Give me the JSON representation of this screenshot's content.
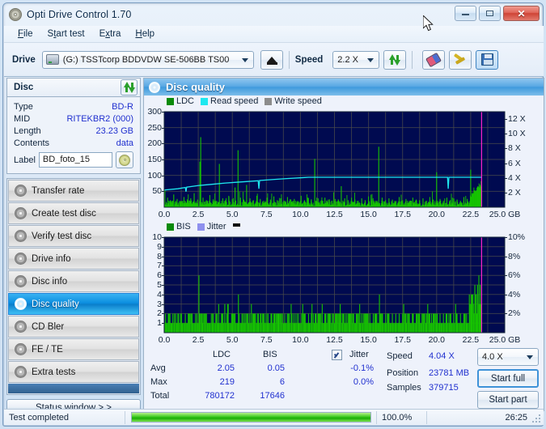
{
  "window": {
    "title": "Opti Drive Control 1.70",
    "icon": "disc-icon",
    "buttons": {
      "minimize": "_",
      "maximize": "□",
      "close": "✕"
    }
  },
  "menu": {
    "items": [
      "File",
      "Start test",
      "Extra",
      "Help"
    ]
  },
  "toolbar": {
    "drive_label": "Drive",
    "drive_value": "(G:)  TSSTcorp BDDVDW SE-506BB TS00",
    "eject_icon": "eject-icon",
    "speed_label": "Speed",
    "speed_value": "2.2 X",
    "refresh_icon": "refresh-icon",
    "erase_icon": "erase-icon",
    "tools_icon": "tools-icon",
    "save_icon": "save-icon"
  },
  "disc": {
    "header": "Disc",
    "refresh_icon": "refresh-icon",
    "fields": [
      {
        "key": "Type",
        "value": "BD-R"
      },
      {
        "key": "MID",
        "value": "RITEKBR2 (000)"
      },
      {
        "key": "Length",
        "value": "23.23 GB"
      },
      {
        "key": "Contents",
        "value": "data"
      }
    ],
    "label_key": "Label",
    "label_value": "BD_foto_15",
    "disc_icon": "cd-icon"
  },
  "nav": {
    "items": [
      {
        "label": "Transfer rate",
        "active": false
      },
      {
        "label": "Create test disc",
        "active": false
      },
      {
        "label": "Verify test disc",
        "active": false
      },
      {
        "label": "Drive info",
        "active": false
      },
      {
        "label": "Disc info",
        "active": false
      },
      {
        "label": "Disc quality",
        "active": true
      },
      {
        "label": "CD Bler",
        "active": false
      },
      {
        "label": "FE / TE",
        "active": false
      },
      {
        "label": "Extra tests",
        "active": false
      }
    ],
    "status_button": "Status window > >"
  },
  "panel": {
    "title": "Disc quality",
    "icon": "disc-quality-icon"
  },
  "stats": {
    "col_ldc": "LDC",
    "col_bis": "BIS",
    "jitter_label": "Jitter",
    "jitter_checked": true,
    "rows": [
      {
        "label": "Avg",
        "ldc": "2.05",
        "bis": "0.05",
        "jitter": "-0.1%"
      },
      {
        "label": "Max",
        "ldc": "219",
        "bis": "6",
        "jitter": "0.0%"
      },
      {
        "label": "Total",
        "ldc": "780172",
        "bis": "17646",
        "jitter": ""
      }
    ],
    "speed_label": "Speed",
    "speed_value": "4.04 X",
    "position_label": "Position",
    "position_value": "23781 MB",
    "samples_label": "Samples",
    "samples_value": "379715",
    "speed_select": "4.0 X",
    "start_full": "Start full",
    "start_part": "Start part"
  },
  "statusbar": {
    "message": "Test completed",
    "percent": "100.0%",
    "percent_value": 100,
    "elapsed": "26:25"
  },
  "colors": {
    "ldc": "#16c400",
    "bis": "#16c400",
    "read_speed": "#1ee8f0",
    "write_speed": "#8c8c8c",
    "jitter": "#8e90ee",
    "plot_bg": "#000a50",
    "marker": "#ff22cc",
    "accent": "#2030cf"
  },
  "chart_data": [
    {
      "type": "line",
      "name": "disc-quality-ldc",
      "title": "Disc quality",
      "xlabel": "GB",
      "ylabel": "LDC",
      "xlim": [
        0,
        25
      ],
      "ylim": [
        0,
        300
      ],
      "y2lim": [
        0,
        12.5
      ],
      "y2label": "X",
      "xticks": [
        "0.0",
        "2.5",
        "5.0",
        "7.5",
        "10.0",
        "12.5",
        "15.0",
        "17.5",
        "20.0",
        "22.5",
        "25.0 GB"
      ],
      "yticks": [
        50,
        100,
        150,
        200,
        250,
        300
      ],
      "y2ticks": [
        "2 X",
        "4 X",
        "6 X",
        "8 X",
        "10 X",
        "12 X"
      ],
      "grid": true,
      "legend": [
        "LDC",
        "Read speed",
        "Write speed"
      ],
      "legend_position": "top-left",
      "marker_x": 23.3,
      "series": [
        {
          "name": "LDC",
          "color": "#16c400",
          "kind": "spikes",
          "baseline": 12,
          "spikes": [
            [
              0.05,
              55
            ],
            [
              0.25,
              30
            ],
            [
              0.45,
              22
            ],
            [
              0.7,
              40
            ],
            [
              0.95,
              26
            ],
            [
              1.2,
              18
            ],
            [
              1.45,
              32
            ],
            [
              1.7,
              20
            ],
            [
              1.95,
              28
            ],
            [
              2.2,
              44
            ],
            [
              2.45,
              24
            ],
            [
              2.62,
              143
            ],
            [
              2.68,
              220
            ],
            [
              2.85,
              30
            ],
            [
              3.1,
              22
            ],
            [
              3.35,
              38
            ],
            [
              3.6,
              25
            ],
            [
              3.85,
              20
            ],
            [
              4.05,
              136
            ],
            [
              4.3,
              28
            ],
            [
              4.5,
              22
            ],
            [
              4.75,
              34
            ],
            [
              5.0,
              26
            ],
            [
              5.2,
              62
            ],
            [
              5.42,
              179
            ],
            [
              5.6,
              30
            ],
            [
              5.85,
              24
            ],
            [
              6.05,
              70
            ],
            [
              6.3,
              28
            ],
            [
              6.55,
              22
            ],
            [
              6.8,
              36
            ],
            [
              7.05,
              26
            ],
            [
              7.3,
              20
            ],
            [
              7.55,
              30
            ],
            [
              7.8,
              24
            ],
            [
              8.05,
              34
            ],
            [
              8.3,
              22
            ],
            [
              8.55,
              28
            ],
            [
              8.8,
              20
            ],
            [
              9.05,
              32
            ],
            [
              9.3,
              24
            ],
            [
              9.55,
              26
            ],
            [
              9.8,
              20
            ],
            [
              10.05,
              36
            ],
            [
              10.3,
              22
            ],
            [
              10.55,
              30
            ],
            [
              10.8,
              25
            ],
            [
              11.05,
              152
            ],
            [
              11.3,
              28
            ],
            [
              11.55,
              22
            ],
            [
              11.8,
              30
            ],
            [
              12.05,
              24
            ],
            [
              12.3,
              20
            ],
            [
              12.55,
              26
            ],
            [
              12.8,
              22
            ],
            [
              13.0,
              66
            ],
            [
              13.25,
              28
            ],
            [
              13.5,
              22
            ],
            [
              13.75,
              30
            ],
            [
              14.0,
              24
            ],
            [
              14.25,
              20
            ],
            [
              14.5,
              28
            ],
            [
              14.75,
              22
            ],
            [
              15.0,
              34
            ],
            [
              15.25,
              26
            ],
            [
              15.5,
              20
            ],
            [
              15.75,
              190
            ],
            [
              16.0,
              30
            ],
            [
              16.25,
              22
            ],
            [
              16.5,
              28
            ],
            [
              16.75,
              24
            ],
            [
              17.0,
              20
            ],
            [
              17.25,
              32
            ],
            [
              17.5,
              22
            ],
            [
              17.75,
              26
            ],
            [
              18.0,
              20
            ],
            [
              18.25,
              30
            ],
            [
              18.5,
              24
            ],
            [
              18.75,
              22
            ],
            [
              19.0,
              28
            ],
            [
              19.25,
              20
            ],
            [
              19.5,
              32
            ],
            [
              19.75,
              24
            ],
            [
              20.0,
              110
            ],
            [
              20.25,
              26
            ],
            [
              20.5,
              20
            ],
            [
              20.75,
              30
            ],
            [
              21.0,
              22
            ],
            [
              21.25,
              28
            ],
            [
              21.5,
              24
            ],
            [
              21.75,
              20
            ],
            [
              22.0,
              32
            ],
            [
              22.25,
              26
            ],
            [
              22.5,
              118
            ],
            [
              22.7,
              40
            ],
            [
              22.85,
              52
            ],
            [
              23.0,
              46
            ],
            [
              23.1,
              58
            ],
            [
              23.2,
              62
            ],
            [
              23.3,
              55
            ]
          ]
        },
        {
          "name": "Read speed",
          "color": "#1ee8f0",
          "kind": "line",
          "points": [
            [
              0.0,
              54
            ],
            [
              1.0,
              58
            ],
            [
              1.55,
              62
            ],
            [
              1.6,
              49
            ],
            [
              1.65,
              63
            ],
            [
              2.5,
              68
            ],
            [
              3.5,
              72
            ],
            [
              4.5,
              76
            ],
            [
              5.5,
              79
            ],
            [
              6.9,
              83
            ],
            [
              6.95,
              58
            ],
            [
              7.0,
              84
            ],
            [
              8.0,
              87
            ],
            [
              9.0,
              90
            ],
            [
              10.2,
              93
            ],
            [
              10.6,
              94
            ],
            [
              13.0,
              94
            ],
            [
              17.0,
              94
            ],
            [
              20.8,
              94
            ],
            [
              20.85,
              58
            ],
            [
              20.9,
              94
            ],
            [
              23.3,
              94
            ]
          ]
        }
      ]
    },
    {
      "type": "bar",
      "name": "disc-quality-bis",
      "xlabel": "GB",
      "ylabel": "BIS",
      "xlim": [
        0,
        25
      ],
      "ylim": [
        0,
        10
      ],
      "y2lim": [
        0,
        10
      ],
      "y2label": "%",
      "xticks": [
        "0.0",
        "2.5",
        "5.0",
        "7.5",
        "10.0",
        "12.5",
        "15.0",
        "17.5",
        "20.0",
        "22.5",
        "25.0 GB"
      ],
      "yticks": [
        1,
        2,
        3,
        4,
        5,
        6,
        7,
        8,
        9,
        10
      ],
      "y2ticks": [
        "2%",
        "4%",
        "6%",
        "8%",
        "10%"
      ],
      "grid": true,
      "legend": [
        "BIS",
        "Jitter",
        ""
      ],
      "legend_position": "top-left",
      "marker_x": 23.3,
      "series": [
        {
          "name": "BIS",
          "color": "#16c400",
          "kind": "spikes",
          "baseline": 1,
          "spikes": [
            [
              0.1,
              2
            ],
            [
              0.3,
              2
            ],
            [
              0.5,
              1
            ],
            [
              0.75,
              2
            ],
            [
              1.0,
              2
            ],
            [
              1.3,
              1
            ],
            [
              1.55,
              2
            ],
            [
              1.8,
              2
            ],
            [
              2.05,
              1
            ],
            [
              2.3,
              2
            ],
            [
              2.55,
              6
            ],
            [
              2.8,
              2
            ],
            [
              3.0,
              2
            ],
            [
              3.3,
              1
            ],
            [
              3.55,
              2
            ],
            [
              3.8,
              2
            ],
            [
              4.0,
              3
            ],
            [
              4.2,
              2
            ],
            [
              4.45,
              2
            ],
            [
              4.7,
              3
            ],
            [
              4.95,
              2
            ],
            [
              5.2,
              2
            ],
            [
              5.45,
              4
            ],
            [
              5.7,
              2
            ],
            [
              5.9,
              2
            ],
            [
              6.15,
              2
            ],
            [
              6.4,
              3
            ],
            [
              6.6,
              2
            ],
            [
              6.85,
              2
            ],
            [
              7.1,
              2
            ],
            [
              7.35,
              2
            ],
            [
              7.6,
              2
            ],
            [
              7.85,
              2
            ],
            [
              8.1,
              2
            ],
            [
              8.35,
              2
            ],
            [
              8.6,
              2
            ],
            [
              8.85,
              2
            ],
            [
              9.1,
              2
            ],
            [
              9.35,
              2
            ],
            [
              9.6,
              2
            ],
            [
              9.85,
              2
            ],
            [
              10.1,
              2
            ],
            [
              10.35,
              2
            ],
            [
              10.6,
              2
            ],
            [
              10.85,
              3
            ],
            [
              11.1,
              2
            ],
            [
              11.35,
              2
            ],
            [
              11.6,
              3
            ],
            [
              11.85,
              2
            ],
            [
              12.1,
              2
            ],
            [
              12.35,
              2
            ],
            [
              12.6,
              2
            ],
            [
              12.85,
              2
            ],
            [
              13.1,
              2
            ],
            [
              13.35,
              2
            ],
            [
              13.6,
              2
            ],
            [
              13.85,
              2
            ],
            [
              14.1,
              2
            ],
            [
              14.35,
              3
            ],
            [
              14.6,
              2
            ],
            [
              14.85,
              2
            ],
            [
              15.1,
              2
            ],
            [
              15.35,
              2
            ],
            [
              15.6,
              2
            ],
            [
              15.8,
              4
            ],
            [
              16.0,
              2
            ],
            [
              16.25,
              2
            ],
            [
              16.5,
              2
            ],
            [
              16.75,
              2
            ],
            [
              17.0,
              2
            ],
            [
              17.25,
              2
            ],
            [
              17.5,
              2
            ],
            [
              17.75,
              2
            ],
            [
              18.0,
              2
            ],
            [
              18.25,
              2
            ],
            [
              18.5,
              2
            ],
            [
              18.75,
              2
            ],
            [
              19.0,
              2
            ],
            [
              19.25,
              2
            ],
            [
              19.5,
              2
            ],
            [
              19.75,
              2
            ],
            [
              20.0,
              2
            ],
            [
              20.25,
              2
            ],
            [
              20.5,
              2
            ],
            [
              20.75,
              2
            ],
            [
              21.0,
              2
            ],
            [
              21.25,
              2
            ],
            [
              21.5,
              2
            ],
            [
              21.75,
              2
            ],
            [
              22.0,
              2
            ],
            [
              22.2,
              2
            ],
            [
              22.4,
              4
            ],
            [
              22.55,
              4
            ],
            [
              22.7,
              3
            ],
            [
              22.8,
              3
            ],
            [
              22.9,
              4
            ],
            [
              23.0,
              5
            ],
            [
              23.1,
              6
            ],
            [
              23.2,
              5
            ],
            [
              23.28,
              3
            ]
          ]
        }
      ]
    }
  ]
}
